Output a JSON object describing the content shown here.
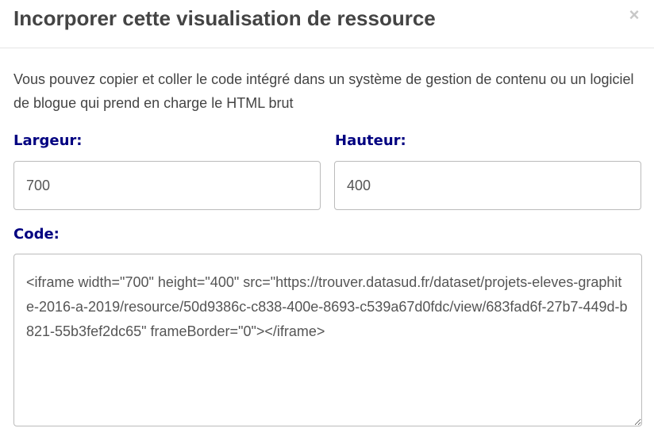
{
  "modal": {
    "title": "Incorporer cette visualisation de ressource",
    "close_symbol": "×",
    "close_icon": "close-icon"
  },
  "intro": {
    "text": "Vous pouvez copier et coller le code intégré dans un système de gestion de contenu ou un logiciel de blogue qui prend en charge le HTML brut"
  },
  "width_field": {
    "label": "Largeur:",
    "value": "700"
  },
  "height_field": {
    "label": "Hauteur:",
    "value": "400"
  },
  "code_field": {
    "label": "Code:",
    "value": "<iframe width=\"700\" height=\"400\" src=\"https://trouver.datasud.fr/dataset/projets-eleves-graphite-2016-a-2019/resource/50d9386c-c838-400e-8693-c539a67d0fdc/view/683fad6f-27b7-449d-b821-55b3fef2dc65\" frameBorder=\"0\"></iframe>"
  },
  "colors": {
    "label_color": "#000080",
    "text_color": "#444444",
    "input_text_color": "#555555",
    "border_color": "#bbbbbb"
  }
}
